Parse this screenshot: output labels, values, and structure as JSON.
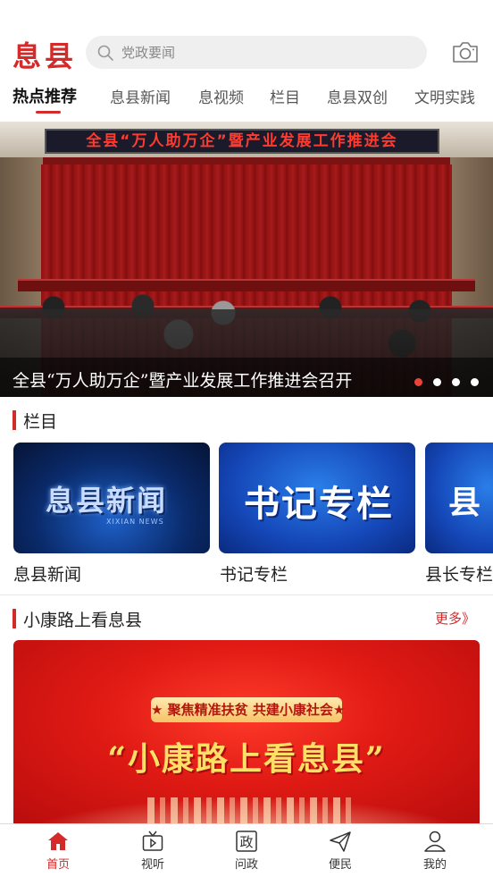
{
  "header": {
    "logo": "息县",
    "search_placeholder": "党政要闻"
  },
  "tabs": [
    {
      "label": "热点推荐",
      "active": true
    },
    {
      "label": "息县新闻"
    },
    {
      "label": "息视频"
    },
    {
      "label": "栏目"
    },
    {
      "label": "息县双创"
    },
    {
      "label": "文明实践"
    }
  ],
  "banner": {
    "stage_sign": "全县“万人助万企”暨产业发展工作推进会",
    "caption": "全县“万人助万企”暨产业发展工作推进会召开",
    "slide_count": 4,
    "active_slide": 1
  },
  "columns_section": {
    "title": "栏目",
    "cards": [
      {
        "label": "息县新闻",
        "art_text": "息县新闻",
        "art_sub": "XIXIAN NEWS"
      },
      {
        "label": "书记专栏",
        "art_text": "书记专栏"
      },
      {
        "label": "县长专栏",
        "art_text": "县"
      }
    ]
  },
  "xiaokang_section": {
    "title": "小康路上看息县",
    "more": "更多》",
    "promo_pill": "★ 聚焦精准扶贫 共建小康社会★",
    "promo_headline": "“小康路上看息县”"
  },
  "bottom_nav": [
    {
      "label": "首页",
      "icon": "home-icon",
      "active": true
    },
    {
      "label": "视听",
      "icon": "tv-icon"
    },
    {
      "label": "问政",
      "icon": "zheng-icon",
      "glyph": "政"
    },
    {
      "label": "便民",
      "icon": "send-icon"
    },
    {
      "label": "我的",
      "icon": "user-icon"
    }
  ],
  "colors": {
    "accent": "#d42a2a",
    "active_dot": "#e8443a"
  }
}
